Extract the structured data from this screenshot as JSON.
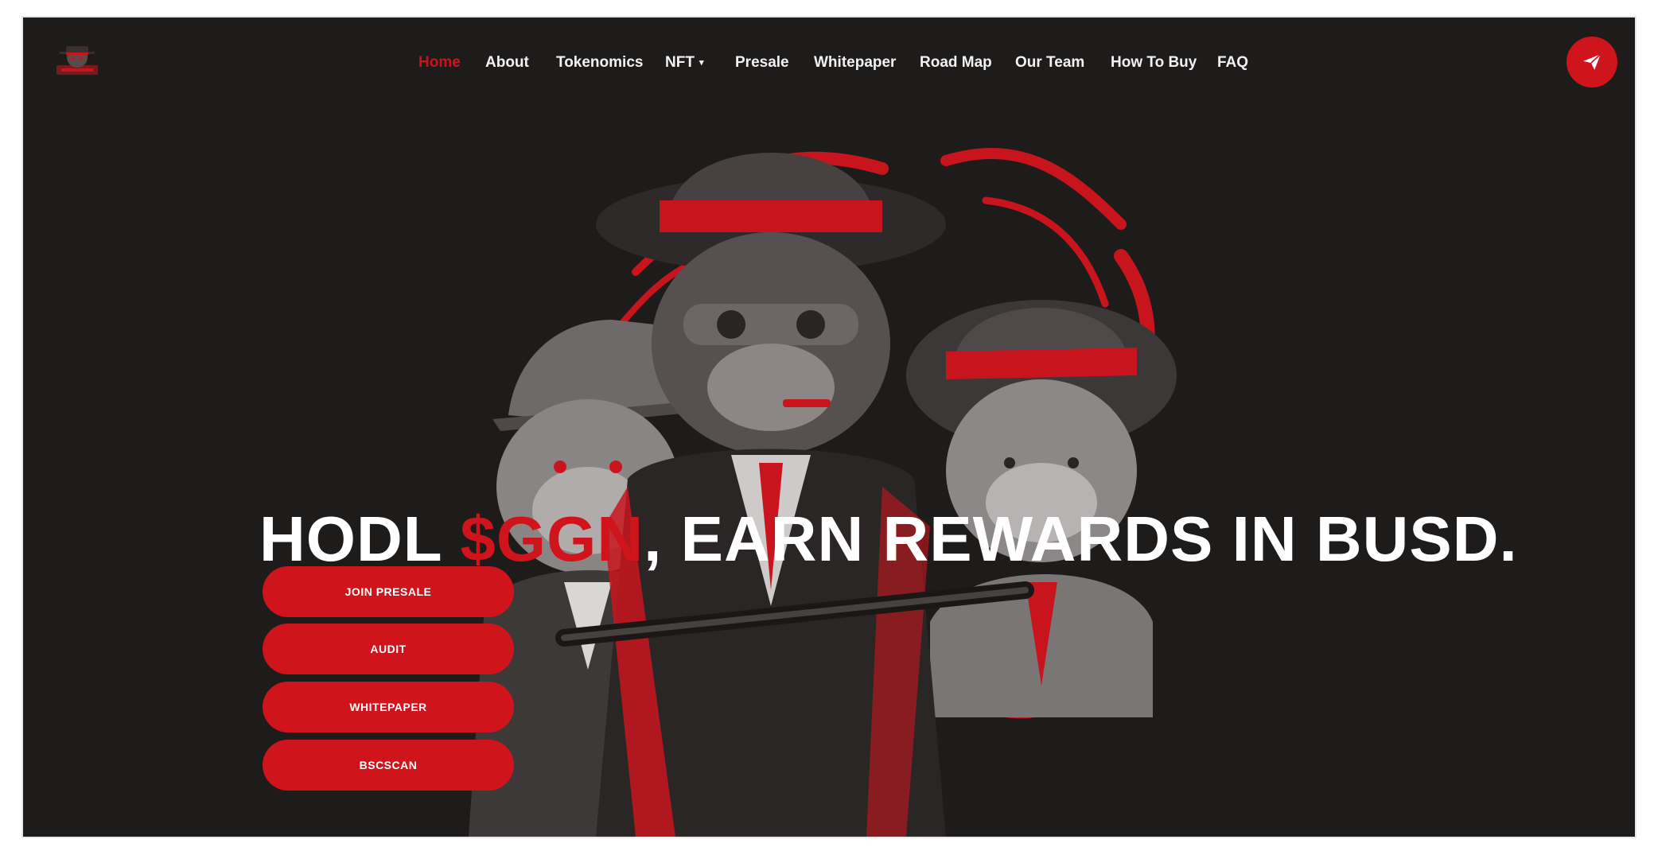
{
  "nav": {
    "items": [
      {
        "label": "Home",
        "active": true
      },
      {
        "label": "About"
      },
      {
        "label": "Tokenomics"
      },
      {
        "label": "NFT",
        "dropdown": true
      },
      {
        "label": "Presale"
      },
      {
        "label": "Whitepaper"
      },
      {
        "label": "Road Map"
      },
      {
        "label": "Our Team"
      },
      {
        "label": "How To Buy"
      },
      {
        "label": "FAQ"
      }
    ],
    "telegram_icon": "telegram-send-icon"
  },
  "hero": {
    "headline_pre": "HODL ",
    "headline_accent": "$GGN",
    "headline_post": ", EARN REWARDS IN BUSD.",
    "buttons": [
      "JOIN PRESALE",
      "AUDIT",
      "WHITEPAPER",
      "BSCSCAN"
    ]
  },
  "colors": {
    "background": "#1e1b1b",
    "accent": "#d0141c",
    "text": "#ffffff"
  }
}
